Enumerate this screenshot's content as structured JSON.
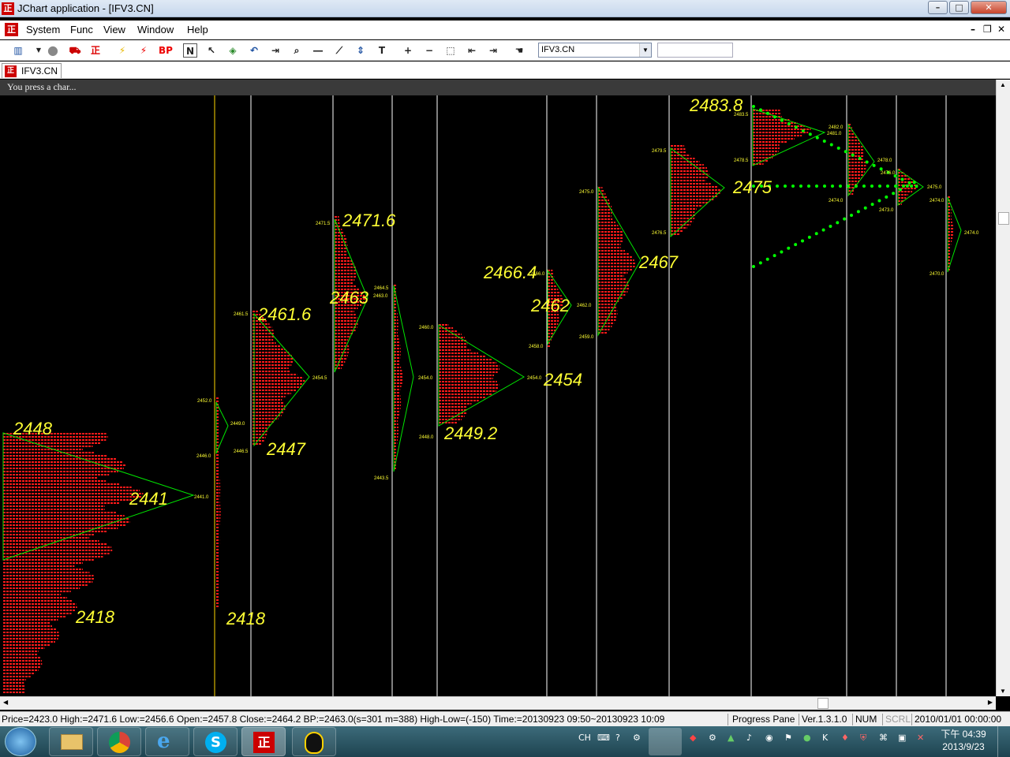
{
  "window": {
    "title": "JChart application - [IFV3.CN]"
  },
  "menu": [
    "System",
    "Func",
    "View",
    "Window",
    "Help"
  ],
  "toolbar": {
    "icons": [
      "chart-type-icon",
      "dropdown-arrow-icon",
      "gray-circle-icon",
      "red-car-icon",
      "logo-icon",
      "yellow-lightning-icon",
      "red-lightning-icon",
      "bp-icon",
      "n-icon",
      "pointer-icon",
      "cube-icon",
      "undo-icon",
      "forward-icon",
      "zoom-icon",
      "hline-icon",
      "trendline-icon",
      "arrow-updown-icon",
      "text-icon",
      "plus-icon",
      "minus-icon",
      "select-rect-icon",
      "back-icon",
      "forward-end-icon",
      "hand-icon"
    ],
    "bp_label": "BP",
    "n_label": "N",
    "symbol": "IFV3.CN",
    "search_value": ""
  },
  "tab": {
    "label": "IFV3.CN"
  },
  "chart_message": "You press a char...",
  "chart_data": {
    "type": "market-profile",
    "sessions": [
      {
        "high_label": "2448",
        "poc_label": "2441",
        "low_label": "2418",
        "poc_tag": "2441.0"
      },
      {
        "low_label": "2418",
        "tags": [
          "2452.0",
          "2449.0",
          "2446.0"
        ]
      },
      {
        "high_label": "2461.6",
        "low_label": "2447",
        "tags": [
          "2461.5",
          "2446.5",
          "2454.5"
        ]
      },
      {
        "high_label": "2471.6",
        "poc_label": "2463",
        "tags": [
          "2471.5"
        ]
      },
      {
        "tags": [
          "2464.5",
          "2463.0",
          "2454.0",
          "2443.5"
        ]
      },
      {
        "low_label": "2449.2",
        "tags": [
          "2460.0",
          "2448.0",
          "2454.0"
        ]
      },
      {
        "high_label": "2466.4",
        "poc_label": "2462",
        "tags": [
          "2466.0",
          "2462.0",
          "2458.0"
        ]
      },
      {
        "poc_label": "2467",
        "tags": [
          "2475.0",
          "2459.0"
        ]
      },
      {
        "poc_label": "2475",
        "tags": [
          "2479.5",
          "2476.5"
        ]
      },
      {
        "high_label": "2483.8",
        "tags": [
          "2483.5",
          "2478.5"
        ]
      },
      {
        "tags": [
          "2482.0",
          "2481.0",
          "2478.0",
          "2474.0"
        ]
      },
      {
        "tags": [
          "2476.0",
          "2475.0",
          "2473.0",
          "2474.0"
        ]
      },
      {
        "tags": [
          "2474.0",
          "2470.0",
          "2466.0"
        ]
      }
    ],
    "extra_labels": [
      "2454"
    ],
    "colors": {
      "profile": "#ff1a1a",
      "triangle": "#00e600",
      "annotation": "#ffff33",
      "divider": "#ffffff",
      "dotted": "#00ff00",
      "current_line": "#ffd700"
    }
  },
  "status": {
    "info": "Price=2423.0  High:=2471.6  Low:=2456.6  Open:=2457.8  Close:=2464.2  BP:=2463.0(s=301 m=388)  High-Low=(-150)  Time:=20130923 09:50~20130923 10:09",
    "pane": "Progress Pane",
    "version": "Ver.1.3.1.0",
    "num": "NUM",
    "scrl": "SCRL",
    "datetime": "2010/01/01 00:00:00"
  },
  "taskbar": {
    "apps": [
      "start-orb-icon",
      "file-explorer-icon",
      "chrome-icon",
      "internet-explorer-icon",
      "skype-icon",
      "jchart-icon",
      "qq-icon"
    ],
    "lang": "CH",
    "time": "下午 04:39",
    "date": "2013/9/23"
  }
}
